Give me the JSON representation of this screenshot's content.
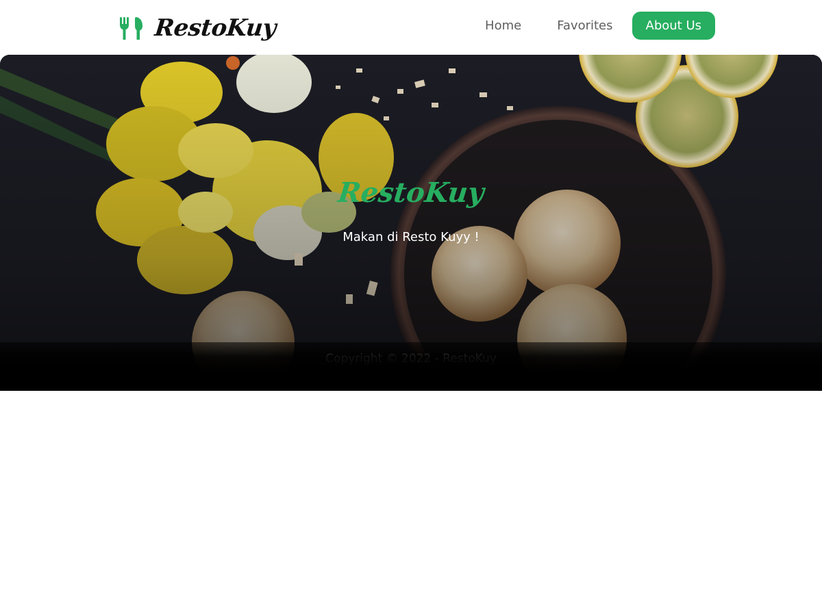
{
  "brand": {
    "name": "RestoKuy",
    "icon": "fork-knife-icon",
    "accent_color": "#27ae60"
  },
  "nav": {
    "items": [
      {
        "label": "Home"
      },
      {
        "label": "Favorites"
      },
      {
        "label": "About Us"
      }
    ],
    "active": "About Us"
  },
  "hero": {
    "title": "RestoKuy",
    "subtitle": "Makan di Resto Kuyy !"
  },
  "footer": {
    "copyright": "Copyright © 2022 - RestoKuy"
  }
}
